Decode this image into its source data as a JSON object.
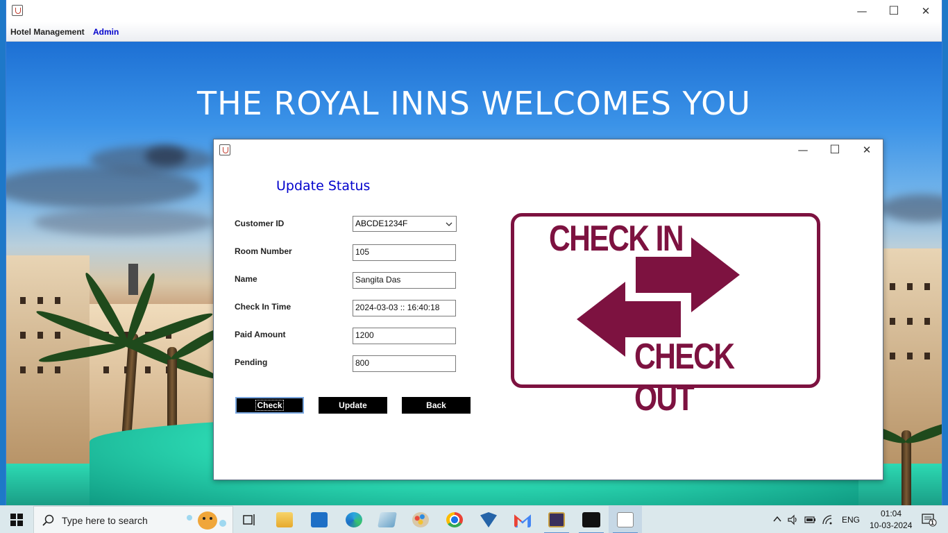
{
  "main_window": {
    "menu": {
      "app_label": "Hotel Management",
      "admin_label": "Admin"
    },
    "controls": {
      "minimize": "—",
      "maximize": "☐",
      "close": "✕"
    },
    "welcome_text": "THE ROYAL INNS WELCOMES YOU"
  },
  "dialog": {
    "heading": "Update Status",
    "controls": {
      "minimize": "—",
      "maximize": "☐",
      "close": "✕"
    },
    "fields": {
      "customer_id": {
        "label": "Customer ID",
        "value": "ABCDE1234F"
      },
      "room_number": {
        "label": "Room Number",
        "value": "105"
      },
      "name": {
        "label": "Name",
        "value": "Sangita Das"
      },
      "check_in_time": {
        "label": "Check In Time",
        "value": "2024-03-03 :: 16:40:18"
      },
      "paid_amount": {
        "label": "Paid Amount",
        "value": "1200"
      },
      "pending": {
        "label": "Pending",
        "value": "800"
      }
    },
    "buttons": {
      "check": "Check",
      "update": "Update",
      "back": "Back"
    },
    "graphic": {
      "check_in": "CHECK IN",
      "check_out": "CHECK OUT",
      "color": "#7d1240"
    }
  },
  "taskbar": {
    "search_placeholder": "Type here to search",
    "language": "ENG",
    "time": "01:04",
    "date": "10-03-2024",
    "notification_count": "1"
  }
}
